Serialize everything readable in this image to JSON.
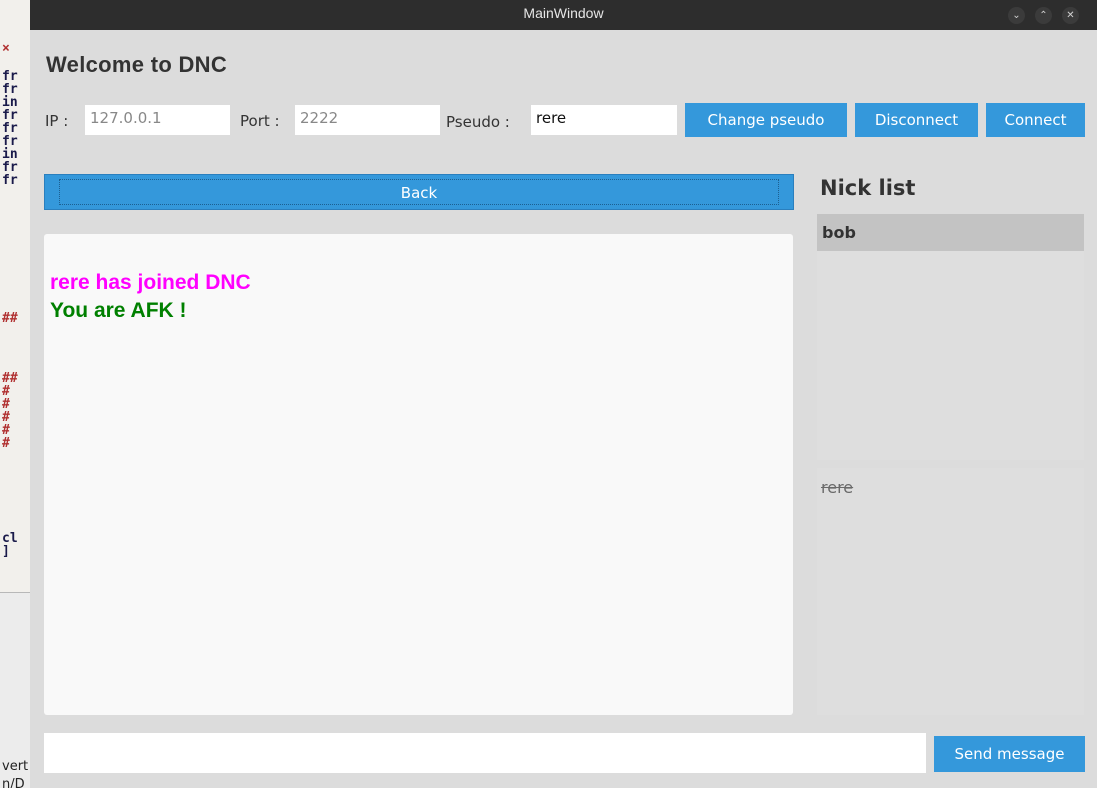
{
  "window": {
    "title": "MainWindow",
    "controls": [
      "chevron-down-icon",
      "chevron-up-icon",
      "close-icon"
    ]
  },
  "header": {
    "title": "Welcome to DNC"
  },
  "connection": {
    "ip_label": "IP :",
    "ip_value": "127.0.0.1",
    "port_label": "Port :",
    "port_value": "2222",
    "pseudo_label": "Pseudo :",
    "pseudo_value": "rere",
    "change_pseudo_label": "Change pseudo",
    "disconnect_label": "Disconnect",
    "connect_label": "Connect"
  },
  "chat": {
    "back_label": "Back",
    "messages": [
      {
        "text": "rere has joined DNC",
        "color": "#ff00ff"
      },
      {
        "text": "You are AFK !",
        "color": "#008000"
      }
    ]
  },
  "nicks": {
    "title": "Nick list",
    "online": [
      "bob"
    ],
    "away": [
      "rere"
    ]
  },
  "composer": {
    "input_value": "",
    "send_label": "Send message"
  },
  "colors": {
    "accent": "#3498db",
    "window_bg": "#dcdcdc"
  }
}
